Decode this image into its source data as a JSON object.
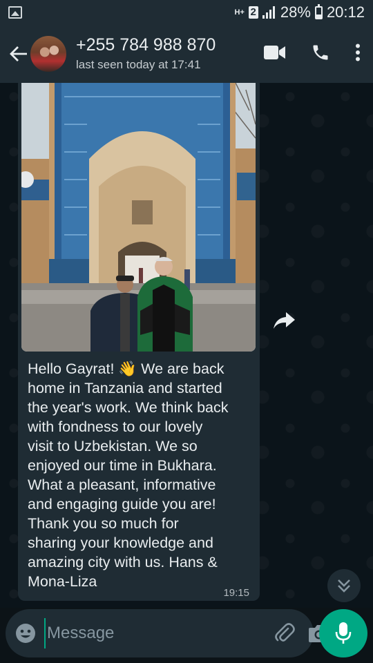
{
  "status_bar": {
    "network_type": "H+",
    "sim_slot": "2",
    "battery": "28%",
    "time": "20:12"
  },
  "header": {
    "contact_name": "+255 784 988 870",
    "last_seen": "last seen today at 17:41"
  },
  "message": {
    "text": "Hello Gayrat! 👋  We are back\nhome in Tanzania and started\nthe year's work. We think back\nwith fondness to our lovely\nvisit to Uzbekistan. We so\nenjoyed our time in Bukhara.\nWhat a pleasant, informative\nand engaging guide you are!\nThank you so much for\nsharing your knowledge and\namazing city with us. Hans &\nMona-Liza",
    "time": "19:15"
  },
  "composer": {
    "placeholder": "Message"
  },
  "colors": {
    "accent": "#00a884",
    "header_bg": "#1f2c34",
    "chat_bg": "#0b141a",
    "bubble_bg": "#1f2c34"
  }
}
